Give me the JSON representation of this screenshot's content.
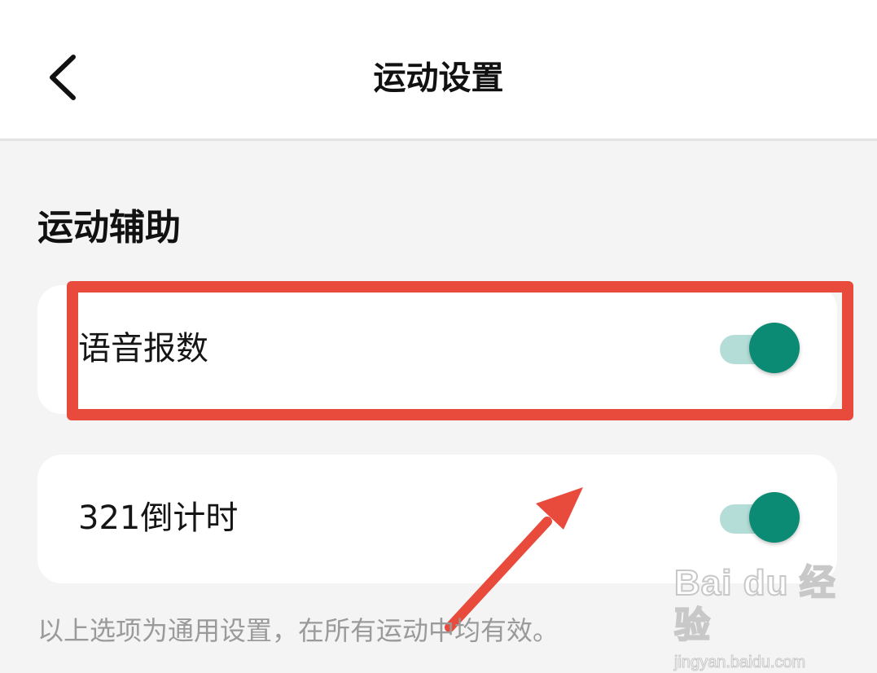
{
  "header": {
    "title": "运动设置",
    "back_icon": "chevron-left-icon"
  },
  "section": {
    "title": "运动辅助"
  },
  "settings": [
    {
      "label": "语音报数",
      "enabled": true
    },
    {
      "label": "321倒计时",
      "enabled": true
    }
  ],
  "footnote": "以上选项为通用设置，在所有运动中均有效。",
  "colors": {
    "toggle_on": "#0b8a74",
    "toggle_track": "#b4ddd7",
    "annotation": "#e84a3c"
  },
  "watermark": {
    "logo": "Bai du 经验",
    "url": "jingyan.baidu.com"
  }
}
